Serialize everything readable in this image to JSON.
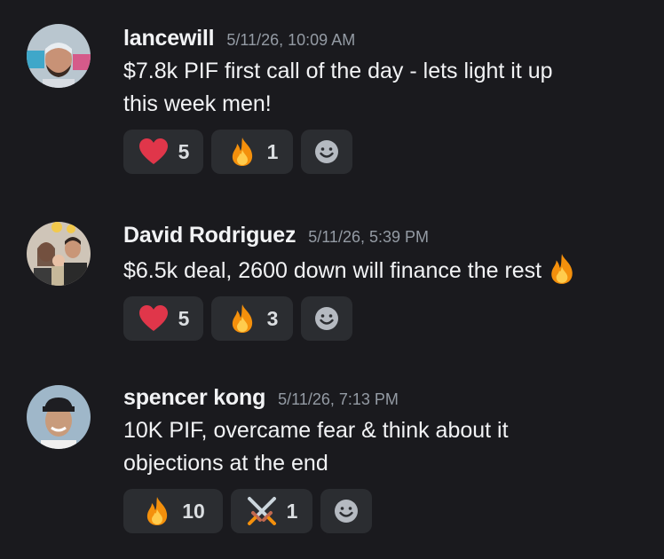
{
  "messages": [
    {
      "username": "lancewill",
      "timestamp": "5/11/26, 10:09 AM",
      "text_line1": "$7.8k PIF first call of the day - lets light it up",
      "text_line2": "this week men!",
      "reactions": [
        {
          "emoji": "heart-emoji",
          "count": "5"
        },
        {
          "emoji": "fire-emoji",
          "count": "1"
        }
      ]
    },
    {
      "username": "David Rodriguez",
      "timestamp": "5/11/26, 5:39 PM",
      "text_line1": "$6.5k deal, 2600 down will finance the rest",
      "inline_emoji": "fire-emoji",
      "reactions": [
        {
          "emoji": "heart-emoji",
          "count": "5"
        },
        {
          "emoji": "fire-emoji",
          "count": "3"
        }
      ]
    },
    {
      "username": "spencer kong",
      "timestamp": "5/11/26, 7:13 PM",
      "text_line1": "10K PIF, overcame fear & think about it",
      "text_line2": "objections at the end",
      "reactions": [
        {
          "emoji": "fire-emoji",
          "count": "10"
        },
        {
          "emoji": "crossed-swords-emoji",
          "count": "1"
        }
      ]
    }
  ],
  "add_reaction_icon": "smiley-add-reaction-icon",
  "colors": {
    "background": "#1a1a1e",
    "reaction_bg": "#2b2d31",
    "username": "#f2f3f5",
    "timestamp": "#949ba4",
    "heart": "#e0364a",
    "fire": "#f4900c"
  }
}
